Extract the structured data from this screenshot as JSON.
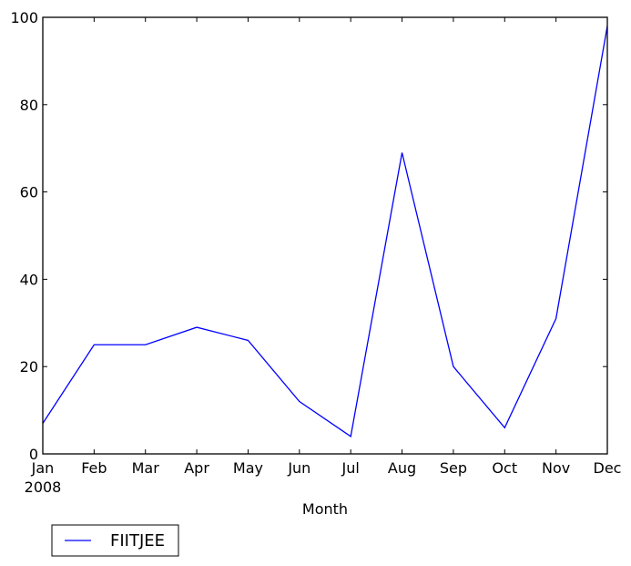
{
  "chart_data": {
    "type": "line",
    "title": "",
    "xlabel": "Month",
    "ylabel": "",
    "categories": [
      "Jan",
      "Feb",
      "Mar",
      "Apr",
      "May",
      "Jun",
      "Jul",
      "Aug",
      "Sep",
      "Oct",
      "Nov",
      "Dec"
    ],
    "x_sublabel": "2008",
    "series": [
      {
        "name": "FIITJEE",
        "color": "#0000ff",
        "values": [
          7,
          25,
          25,
          29,
          26,
          12,
          4,
          69,
          20,
          6,
          31,
          98
        ]
      }
    ],
    "ylim": [
      0,
      100
    ],
    "yticks": [
      0,
      20,
      40,
      60,
      80,
      100
    ],
    "grid": false,
    "legend_position": "below-left"
  }
}
